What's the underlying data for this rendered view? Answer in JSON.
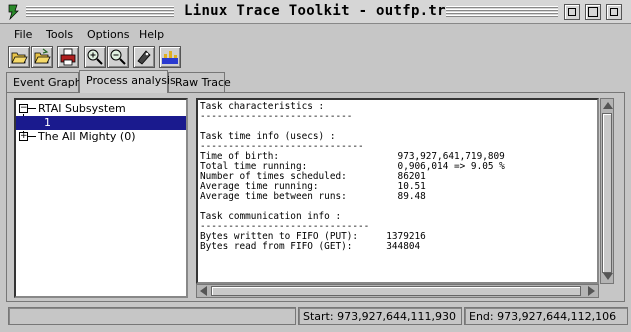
{
  "window": {
    "title": "Linux Trace Toolkit - outfp.trace"
  },
  "menu": [
    "File",
    "Tools",
    "Options",
    "Help"
  ],
  "toolbar": [
    "open-icon",
    "open-folder-icon",
    "print-icon",
    "zoom-in-icon",
    "zoom-out-icon",
    "tag-icon",
    "chart-icon"
  ],
  "tabs": [
    "Event Graph",
    "Process analysis",
    "Raw Trace"
  ],
  "active_tab": "Process analysis",
  "tree": {
    "root": "RTAI Subsystem",
    "selected_child": "1",
    "sibling": "The All Mighty (0)"
  },
  "details": {
    "task_characteristics": "Task characteristics :",
    "time_info_header": "Task time info (usecs) :",
    "rows": [
      {
        "label": "Time of birth:",
        "value": "973,927,641,719,809"
      },
      {
        "label": "Total time running:",
        "value": "0,906,014 => 9.05 %"
      },
      {
        "label": "Number of times scheduled:",
        "value": "86201"
      },
      {
        "label": "Average time running:",
        "value": "10.51"
      },
      {
        "label": "Average time between runs:",
        "value": "89.48"
      }
    ],
    "comm_header": "Task communication info :",
    "comm_rows": [
      {
        "label": "Bytes written to FIFO (PUT):",
        "value": "1379216"
      },
      {
        "label": "Bytes read from FIFO (GET):",
        "value": "344804"
      }
    ]
  },
  "status": {
    "left": "",
    "start": "Start: 973,927,644,111,930",
    "end": "End: 973,927,644,112,106"
  }
}
